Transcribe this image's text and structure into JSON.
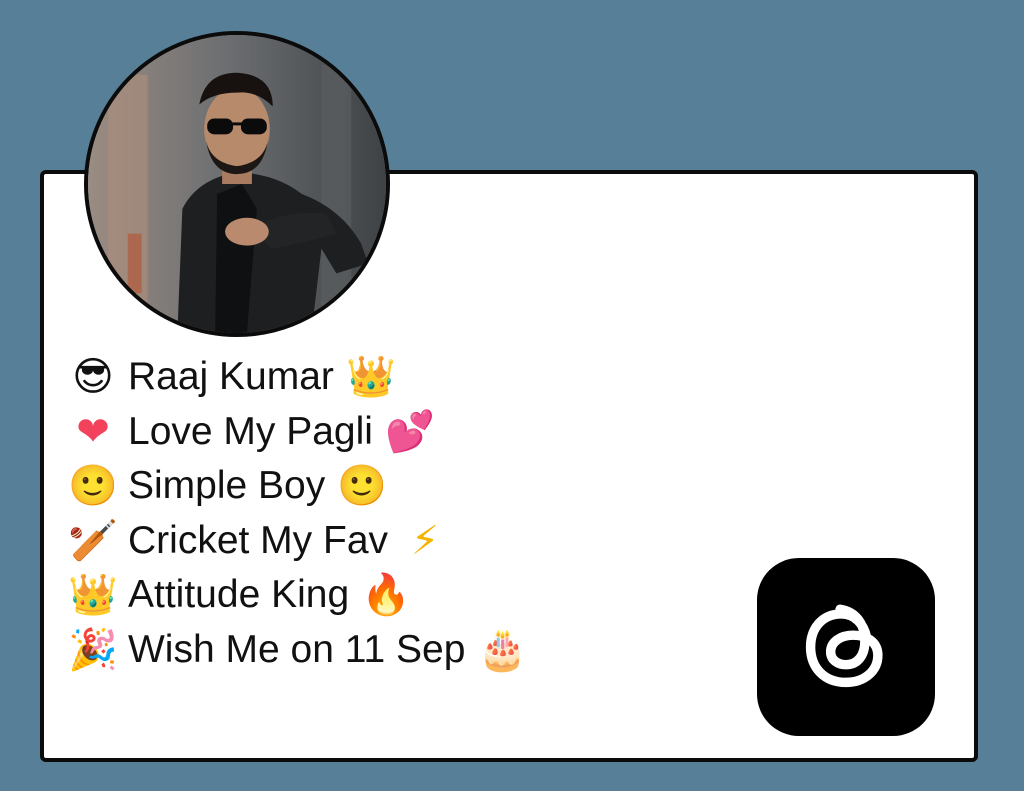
{
  "profile": {
    "avatar_icon": "profile-photo-man-sunglasses",
    "bio_lines": [
      {
        "lead_icon": "sunglasses-face-icon",
        "lead": "😎",
        "text": "Raaj Kumar",
        "trail_icon": "crown-icon",
        "trail": "👑"
      },
      {
        "lead_icon": "red-heart-icon",
        "lead": "❤",
        "text": "Love My Pagli",
        "trail_icon": "two-hearts-icon",
        "trail": "💕"
      },
      {
        "lead_icon": "slight-smile-icon",
        "lead": "🙂",
        "text": "Simple Boy",
        "trail_icon": "slight-smile-icon",
        "trail": "🙂"
      },
      {
        "lead_icon": "cricket-bat-icon",
        "lead": "🏏",
        "text": "Cricket My Fav",
        "trail_icon": "lightning-icon",
        "trail": "⚡"
      },
      {
        "lead_icon": "crown-icon",
        "lead": "👑",
        "text": "Attitude King",
        "trail_icon": "fire-icon",
        "trail": "🔥"
      },
      {
        "lead_icon": "party-popper-icon",
        "lead": "🎉",
        "text": "Wish Me on 11 Sep",
        "trail_icon": "birthday-cake-icon",
        "trail": "🎂"
      }
    ]
  },
  "logo": {
    "icon": "threads-logo-icon"
  },
  "colors": {
    "background": "#587f98",
    "card": "#ffffff",
    "border": "#0b0b0b",
    "logo_bg": "#000000"
  }
}
